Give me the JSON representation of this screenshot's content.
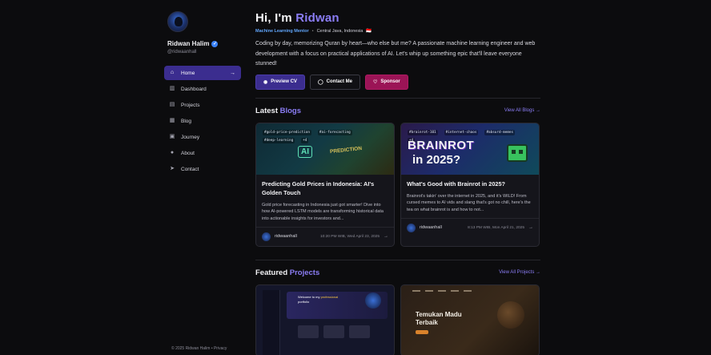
{
  "profile": {
    "name": "Ridwan Halim",
    "handle": "@ridwaanhall",
    "greeting_prefix": "Hi, I'm ",
    "greeting_name": "Ridwan",
    "role": "Machine Learning Mentor",
    "location": "Central Java, Indonesia",
    "location_flag": "🇮🇩",
    "bio": "Coding by day, memorizing Quran by heart—who else but me? A passionate machine learning engineer and web development with a focus on practical applications of AI. Let's whip up something epic that'll leave everyone stunned!"
  },
  "nav": {
    "items": [
      {
        "label": "Home",
        "icon": "home-icon",
        "active": true
      },
      {
        "label": "Dashboard",
        "icon": "chart-icon",
        "active": false
      },
      {
        "label": "Projects",
        "icon": "folder-icon",
        "active": false
      },
      {
        "label": "Blog",
        "icon": "document-icon",
        "active": false
      },
      {
        "label": "Journey",
        "icon": "briefcase-icon",
        "active": false
      },
      {
        "label": "About",
        "icon": "user-icon",
        "active": false
      },
      {
        "label": "Contact",
        "icon": "send-icon",
        "active": false
      }
    ]
  },
  "actions": {
    "preview_cv": "Preview CV",
    "contact_me": "Contact Me",
    "sponsor": "Sponsor"
  },
  "blogs": {
    "title_prefix": "Latest ",
    "title_accent": "Blogs",
    "view_all": "View All Blogs",
    "items": [
      {
        "tags": [
          "#gold-price-prediction",
          "#ai-forecasting",
          "#deep-learning",
          "+4"
        ],
        "image_text_1": "AI",
        "image_text_2": "PREDICTION",
        "title": "Predicting Gold Prices in Indonesia: AI's Golden Touch",
        "desc": "Gold price forecasting in Indonesia just got smarter! Dive into how AI-powered LSTM models are transforming historical data into actionable insights for investors and...",
        "author": "ridwaanhall",
        "date": "10:20 PM WIB, Wed April 23, 2025"
      },
      {
        "tags": [
          "#brainrot-101",
          "#internet-chaos",
          "#absurd-memes",
          "+4"
        ],
        "image_text_1": "BRAINROT",
        "image_text_2": "in 2025?",
        "title": "What's Good with Brainrot in 2025?",
        "desc": "Brainrot's takin' over the internet in 2025, and it's WILD! From cursed memes to AI vids and slang that's got no chill, here's the tea on what brainrot is and how to not...",
        "author": "ridwaanhall",
        "date": "8:13 PM WIB, Mon April 21, 2025"
      }
    ]
  },
  "projects": {
    "title_prefix": "Featured ",
    "title_accent": "Projects",
    "view_all": "View All Projects",
    "items": [
      {
        "hero_text": "Welcome to my ",
        "hero_highlight": "professional",
        "hero_text_2": " portfolio"
      },
      {
        "title": "Temukan Madu Terbaik"
      }
    ]
  },
  "footer": {
    "text": "© 2025 Ridwan Halim • Privacy"
  },
  "colors": {
    "accent": "#8b7df5",
    "active_nav": "#3b2d8f",
    "sponsor": "#9b1456",
    "role": "#60a5fa",
    "background": "#0c0c0e"
  }
}
